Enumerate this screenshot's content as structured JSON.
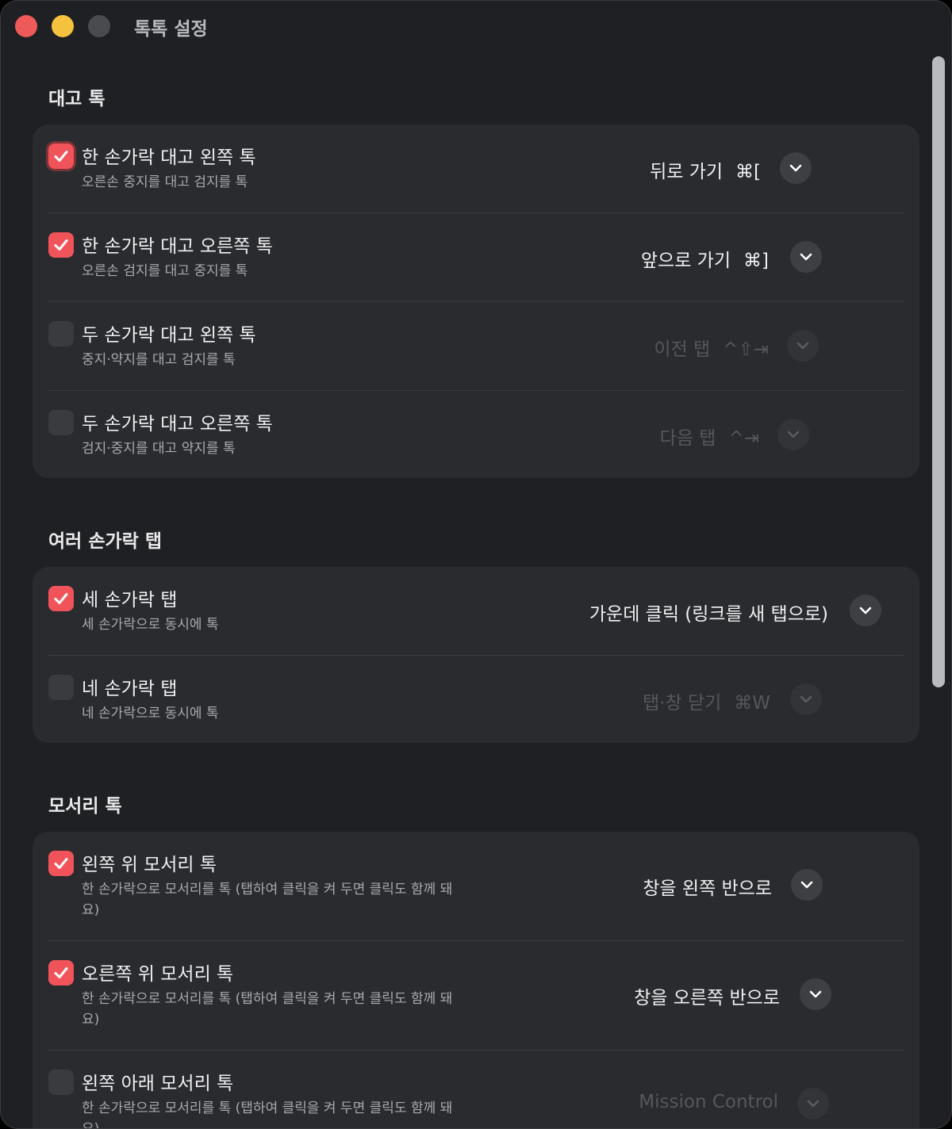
{
  "window": {
    "title": "톡톡 설정"
  },
  "sections": [
    {
      "title": "대고 톡",
      "rows": [
        {
          "title": "한 손가락 대고 왼쪽 톡",
          "subtitle": "오른손 중지를 대고 검지를 톡",
          "checked": true,
          "action": "뒤로 가기",
          "shortcut": "⌘["
        },
        {
          "title": "한 손가락 대고 오른쪽 톡",
          "subtitle": "오른손 검지를 대고 중지를 톡",
          "checked": true,
          "action": "앞으로 가기",
          "shortcut": "⌘]"
        },
        {
          "title": "두 손가락 대고 왼쪽 톡",
          "subtitle": "중지·약지를 대고 검지를 톡",
          "checked": false,
          "action": "이전 탭",
          "shortcut": "^⇧⇥"
        },
        {
          "title": "두 손가락 대고 오른쪽 톡",
          "subtitle": "검지·중지를 대고 약지를 톡",
          "checked": false,
          "action": "다음 탭",
          "shortcut": "^⇥"
        }
      ]
    },
    {
      "title": "여러 손가락 탭",
      "rows": [
        {
          "title": "세 손가락 탭",
          "subtitle": "세 손가락으로 동시에 톡",
          "checked": true,
          "action": "가운데 클릭 (링크를 새 탭으로)",
          "shortcut": ""
        },
        {
          "title": "네 손가락 탭",
          "subtitle": "네 손가락으로 동시에 톡",
          "checked": false,
          "action": "탭·창 닫기",
          "shortcut": "⌘W"
        }
      ]
    },
    {
      "title": "모서리 톡",
      "rows": [
        {
          "title": "왼쪽 위 모서리 톡",
          "subtitle": "한 손가락으로 모서리를 톡 (탭하여 클릭을 켜 두면 클릭도 함께 돼요)",
          "checked": true,
          "action": "창을 왼쪽 반으로",
          "shortcut": ""
        },
        {
          "title": "오른쪽 위 모서리 톡",
          "subtitle": "한 손가락으로 모서리를 톡 (탭하여 클릭을 켜 두면 클릭도 함께 돼요)",
          "checked": true,
          "action": "창을 오른쪽 반으로",
          "shortcut": ""
        },
        {
          "title": "왼쪽 아래 모서리 톡",
          "subtitle": "한 손가락으로 모서리를 톡 (탭하여 클릭을 켜 두면 클릭도 함께 돼요)",
          "checked": false,
          "action": "Mission Control",
          "shortcut": ""
        }
      ]
    }
  ],
  "icons": {
    "checkmark": "checkmark-icon",
    "chevron": "chevron-down-icon"
  },
  "colors": {
    "accent": "#f0545a",
    "background": "#1f2023",
    "card": "#2a2b2f"
  }
}
